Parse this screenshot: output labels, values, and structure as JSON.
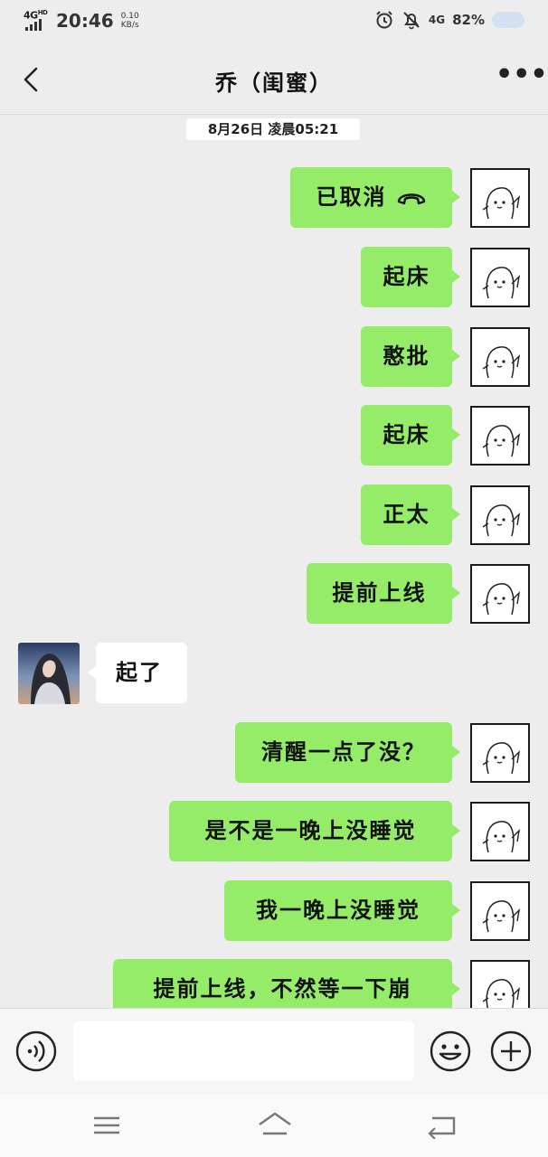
{
  "status_bar": {
    "network_left": "4G",
    "network_left_sup": "HD",
    "time": "20:46",
    "speed_value": "0.10",
    "speed_unit": "KB/s",
    "network_right": "4G",
    "battery": "82%",
    "icons": [
      "alarm-icon",
      "mute-bell-icon",
      "signal-icon",
      "battery-icon"
    ]
  },
  "header": {
    "title": "乔（闺蜜）",
    "back_icon": "chevron-left-icon",
    "more_icon": "more-dots-icon",
    "more_label": "•••"
  },
  "timestamp": "8月26日 凌晨05:21",
  "messages": [
    {
      "sender": "me",
      "text": "已取消",
      "icon": "hang-up-icon"
    },
    {
      "sender": "me",
      "text": "起床"
    },
    {
      "sender": "me",
      "text": "憨批"
    },
    {
      "sender": "me",
      "text": "起床"
    },
    {
      "sender": "me",
      "text": "正太"
    },
    {
      "sender": "me",
      "text": "提前上线"
    },
    {
      "sender": "them",
      "text": "起了"
    },
    {
      "sender": "me",
      "text": "清醒一点了没？"
    },
    {
      "sender": "me",
      "text": "是不是一晚上没睡觉"
    },
    {
      "sender": "me",
      "text": "我一晚上没睡觉"
    },
    {
      "sender": "me",
      "text": "提前上线，不然等一下崩"
    }
  ],
  "input_bar": {
    "placeholder": "",
    "icons": [
      "voice-icon",
      "emoji-icon",
      "plus-icon"
    ]
  },
  "nav_bar": {
    "icons": [
      "menu-icon",
      "home-icon",
      "back-icon"
    ]
  },
  "colors": {
    "my_bubble": "#95ec69",
    "their_bubble": "#ffffff",
    "background": "#ededed"
  }
}
